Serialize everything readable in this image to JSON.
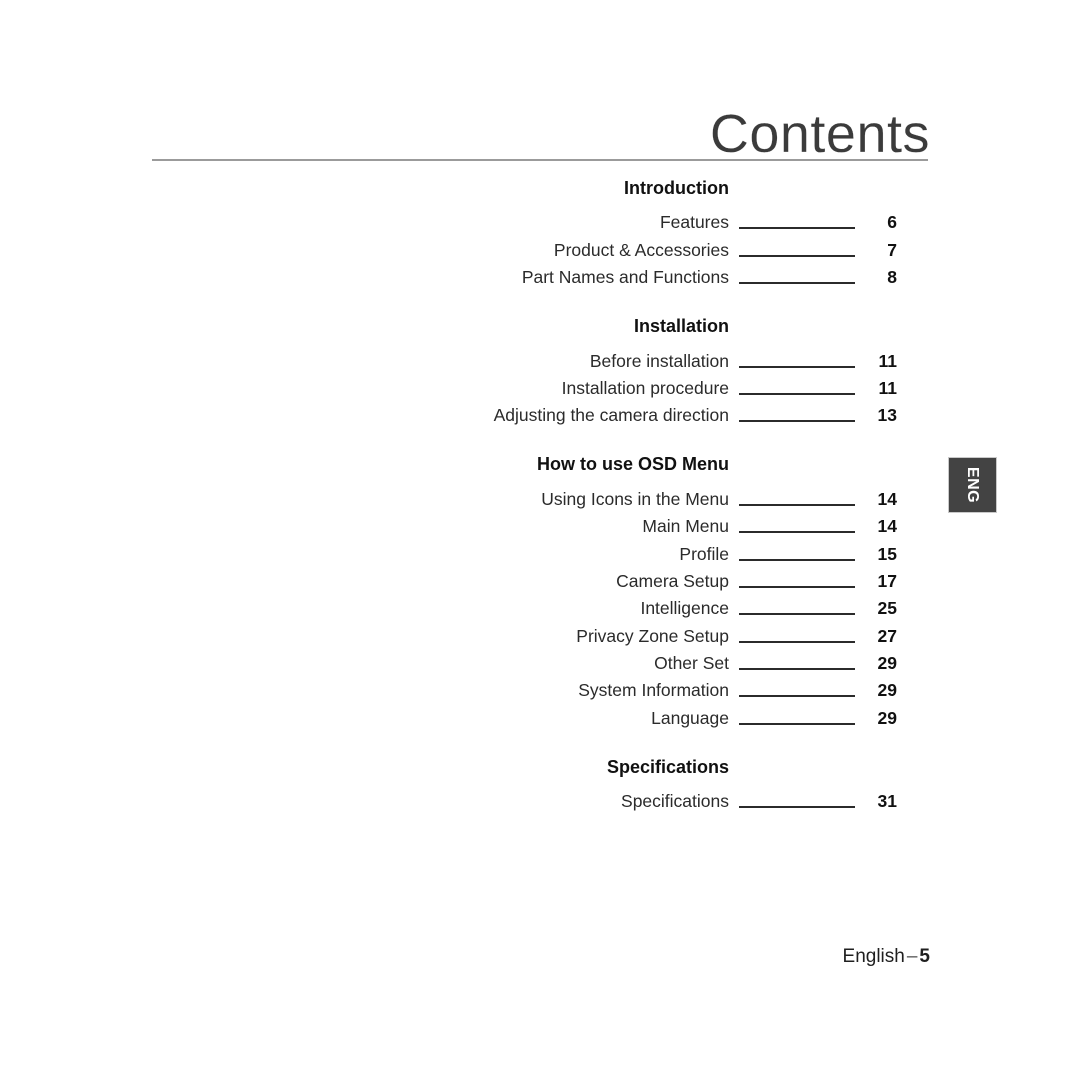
{
  "document": {
    "title": "Contents",
    "language_tab": "ENG",
    "footer": {
      "language": "English",
      "separator": "–",
      "page_number": "5"
    },
    "colors": {
      "header_rule": "#9b9b9b",
      "title_text": "#3b3b3b",
      "body_text": "#2b2b2b",
      "leader_line": "#2b2b2b",
      "lang_tab_background": "#434343",
      "lang_tab_text": "#ffffff",
      "page_background": "#ffffff"
    }
  },
  "toc": {
    "sections": [
      {
        "heading": "Introduction",
        "entries": [
          {
            "title": "Features",
            "page": "6"
          },
          {
            "title": "Product & Accessories",
            "page": "7"
          },
          {
            "title": "Part Names and Functions",
            "page": "8"
          }
        ]
      },
      {
        "heading": "Installation",
        "entries": [
          {
            "title": "Before installation",
            "page": "11"
          },
          {
            "title": "Installation procedure",
            "page": "11"
          },
          {
            "title": "Adjusting the camera direction",
            "page": "13"
          }
        ]
      },
      {
        "heading": "How to use OSD Menu",
        "entries": [
          {
            "title": "Using Icons in the Menu",
            "page": "14"
          },
          {
            "title": "Main Menu",
            "page": "14"
          },
          {
            "title": "Profile",
            "page": "15"
          },
          {
            "title": "Camera Setup",
            "page": "17"
          },
          {
            "title": "Intelligence",
            "page": "25"
          },
          {
            "title": "Privacy Zone Setup",
            "page": "27"
          },
          {
            "title": "Other Set",
            "page": "29"
          },
          {
            "title": "System Information",
            "page": "29"
          },
          {
            "title": "Language",
            "page": "29"
          }
        ]
      },
      {
        "heading": "Specifications",
        "entries": [
          {
            "title": "Specifications",
            "page": "31"
          }
        ]
      }
    ]
  }
}
